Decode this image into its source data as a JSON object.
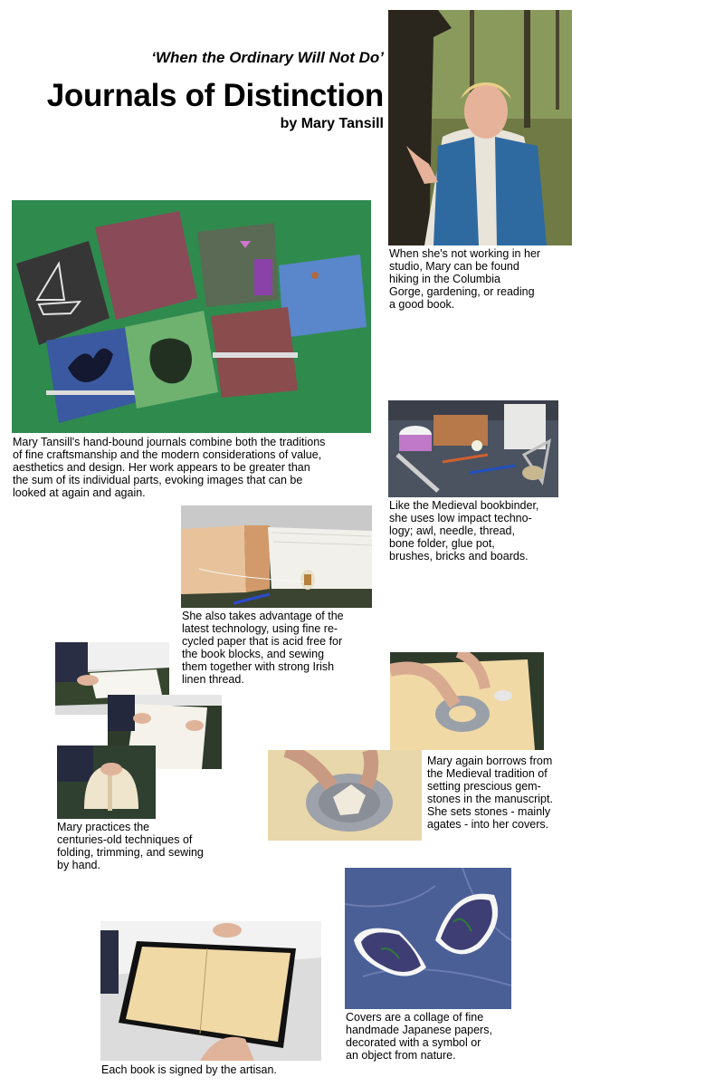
{
  "header": {
    "tagline": "‘When the Ordinary Will Not Do’",
    "title": "Journals of Distinction",
    "byline": "by Mary Tansill"
  },
  "captions": {
    "portrait": "When she's not working in her\nstudio, Mary can be found\nhiking in the Columbia\nGorge, gardening, or reading\na good book.",
    "journals": "Mary Tansill's hand-bound journals combine both the traditions\nof fine craftsmanship and the modern considerations of value,\naesthetics and design.  Her work appears to be greater than\nthe sum of its individual parts, evoking images that can be\nlooked at again and again.",
    "tools": "Like the Medieval bookbinder,\nshe uses low impact techno-\nlogy; awl, needle, thread,\nbone folder, glue pot,\nbrushes, bricks and boards.",
    "paper": "She also takes advantage of the\nlatest technology, using fine re-\ncycled paper that is acid free for\nthe book blocks, and sewing\nthem together with strong Irish\nlinen thread.",
    "gems": "Mary again borrows from\nthe Medieval tradition of\nsetting prescious gem-\nstones in the manuscript.\nShe sets stones - mainly\nagates - into her covers.",
    "folding": "Mary practices the\ncenturies-old techniques of\nfolding, trimming, and sewing\nby hand.",
    "covers": "Covers are a collage of fine\nhandmade Japanese papers,\ndecorated with a symbol or\nan object from nature.",
    "signed": "Each book is signed by the artisan."
  },
  "colors": {
    "felt_green": "#2f8a4e",
    "forest": "#4f5a34",
    "vest_blue": "#2e6aa0",
    "board_green": "#33452e",
    "paper_cream": "#f1d9a6",
    "cover_blue": "#4a5f96"
  }
}
